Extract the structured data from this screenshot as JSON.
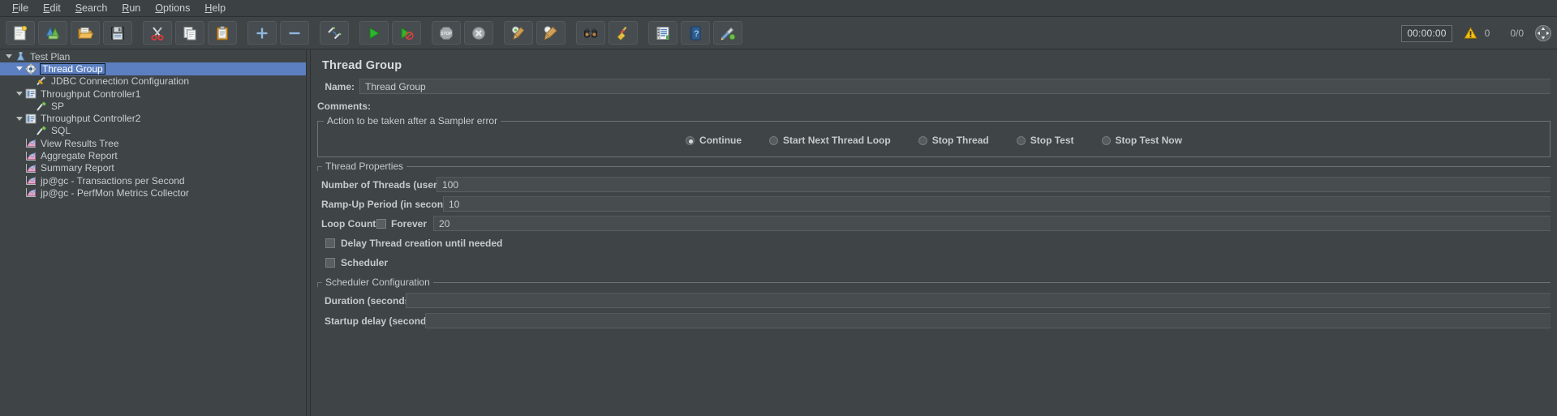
{
  "menubar": {
    "items": [
      {
        "label": "File",
        "mnemonic": "F"
      },
      {
        "label": "Edit",
        "mnemonic": "E"
      },
      {
        "label": "Search",
        "mnemonic": "S"
      },
      {
        "label": "Run",
        "mnemonic": "R"
      },
      {
        "label": "Options",
        "mnemonic": "O"
      },
      {
        "label": "Help",
        "mnemonic": "H"
      }
    ]
  },
  "toolbar": {
    "buttons": [
      {
        "name": "new-button",
        "icon": "new-document-icon",
        "tooltip": "New"
      },
      {
        "name": "templates-button",
        "icon": "templates-icon",
        "tooltip": "Templates"
      },
      {
        "name": "open-button",
        "icon": "open-folder-icon",
        "tooltip": "Open"
      },
      {
        "name": "save-button",
        "icon": "save-floppy-icon",
        "tooltip": "Save Test Plan"
      },
      {
        "name": "cut-button",
        "icon": "scissors-icon",
        "tooltip": "Cut"
      },
      {
        "name": "copy-button",
        "icon": "copy-icon",
        "tooltip": "Copy"
      },
      {
        "name": "paste-button",
        "icon": "clipboard-paste-icon",
        "tooltip": "Paste"
      },
      {
        "name": "expand-all-button",
        "icon": "plus-icon",
        "tooltip": "Expand All"
      },
      {
        "name": "collapse-all-button",
        "icon": "minus-icon",
        "tooltip": "Collapse All"
      },
      {
        "name": "toggle-button",
        "icon": "toggle-pencils-icon",
        "tooltip": "Toggle"
      },
      {
        "name": "start-button",
        "icon": "play-green-icon",
        "tooltip": "Start"
      },
      {
        "name": "start-no-pauses-button",
        "icon": "play-no-pause-icon",
        "tooltip": "Start no pauses"
      },
      {
        "name": "stop-button",
        "icon": "stop-sign-icon",
        "tooltip": "Stop"
      },
      {
        "name": "shutdown-button",
        "icon": "shutdown-x-icon",
        "tooltip": "Shutdown"
      },
      {
        "name": "clear-button",
        "icon": "clear-broom-gear-icon",
        "tooltip": "Clear"
      },
      {
        "name": "clear-all-button",
        "icon": "clear-all-broom-icon",
        "tooltip": "Clear All"
      },
      {
        "name": "search-button",
        "icon": "binoculars-icon",
        "tooltip": "Search"
      },
      {
        "name": "search-reset-button",
        "icon": "broom-icon",
        "tooltip": "Reset Search"
      },
      {
        "name": "function-helper-button",
        "icon": "notebook-icon",
        "tooltip": "Function Helper Dialog"
      },
      {
        "name": "help-button",
        "icon": "help-book-icon",
        "tooltip": "Help"
      },
      {
        "name": "undo-redo-button",
        "icon": "paint-tools-icon",
        "tooltip": "Tools"
      }
    ],
    "timer": "00:00:00",
    "warning_count": "0",
    "thread_ratio": "0/0",
    "expand_icon": "expand-arrows-icon"
  },
  "tree": {
    "items": [
      {
        "label": "Test Plan",
        "indent": 0,
        "twisty": true,
        "icon": "test-plan-icon",
        "selected": false
      },
      {
        "label": "Thread Group",
        "indent": 1,
        "twisty": true,
        "icon": "thread-group-gear-icon",
        "selected": true
      },
      {
        "label": "JDBC Connection Configuration",
        "indent": 2,
        "twisty": false,
        "icon": "jdbc-config-icon",
        "selected": false
      },
      {
        "label": "Throughput Controller1",
        "indent": 1,
        "twisty": true,
        "icon": "controller-icon",
        "selected": false
      },
      {
        "label": "SP",
        "indent": 2,
        "twisty": false,
        "icon": "jdbc-request-icon",
        "selected": false
      },
      {
        "label": "Throughput Controller2",
        "indent": 1,
        "twisty": true,
        "icon": "controller-icon",
        "selected": false
      },
      {
        "label": "SQL",
        "indent": 2,
        "twisty": false,
        "icon": "jdbc-request-icon",
        "selected": false
      },
      {
        "label": "View Results Tree",
        "indent": 1,
        "twisty": false,
        "icon": "listener-chart-icon",
        "selected": false
      },
      {
        "label": "Aggregate Report",
        "indent": 1,
        "twisty": false,
        "icon": "listener-chart-icon",
        "selected": false
      },
      {
        "label": "Summary Report",
        "indent": 1,
        "twisty": false,
        "icon": "listener-chart-icon",
        "selected": false
      },
      {
        "label": "jp@gc - Transactions per Second",
        "indent": 1,
        "twisty": false,
        "icon": "listener-chart-icon",
        "selected": false
      },
      {
        "label": "jp@gc - PerfMon Metrics Collector",
        "indent": 1,
        "twisty": false,
        "icon": "listener-chart-icon",
        "selected": false
      }
    ]
  },
  "panel": {
    "title": "Thread Group",
    "name_label": "Name:",
    "name_value": "Thread Group",
    "comments_label": "Comments:",
    "comments_value": "",
    "sampler_error": {
      "group_title": "Action to be taken after a Sampler error",
      "options": [
        {
          "label": "Continue",
          "checked": true
        },
        {
          "label": "Start Next Thread Loop",
          "checked": false
        },
        {
          "label": "Stop Thread",
          "checked": false
        },
        {
          "label": "Stop Test",
          "checked": false
        },
        {
          "label": "Stop Test Now",
          "checked": false
        }
      ]
    },
    "thread_properties": {
      "group_title": "Thread Properties",
      "num_threads_label": "Number of Threads (users):",
      "num_threads_value": "100",
      "rampup_label": "Ramp-Up Period (in seconds):",
      "rampup_value": "10",
      "loop_count_label": "Loop Count:",
      "forever_label": "Forever",
      "forever_checked": false,
      "loop_count_value": "20",
      "delay_thread_label": "Delay Thread creation until needed",
      "delay_thread_checked": false,
      "scheduler_label": "Scheduler",
      "scheduler_checked": false
    },
    "scheduler_configuration": {
      "group_title": "Scheduler Configuration",
      "duration_label": "Duration (seconds)",
      "duration_value": "",
      "startup_delay_label": "Startup delay (seconds)",
      "startup_delay_value": ""
    }
  },
  "colors": {
    "background": "#3f4447",
    "selection": "#5b7fc0",
    "text": "#c8cccd",
    "border": "#6f7477",
    "warning": "#f5c518"
  }
}
